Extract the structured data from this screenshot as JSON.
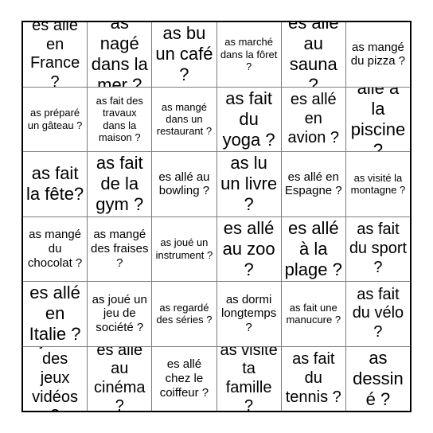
{
  "card": {
    "type": "bingo-card",
    "columns": 6,
    "rows": 6,
    "grid": [
      [
        {
          "text": "es allé en France ?",
          "size": "fs-lg"
        },
        {
          "text": "as nagé dans la mer ?",
          "size": "fs-xl"
        },
        {
          "text": "as bu un café ?",
          "size": "fs-xl"
        },
        {
          "text": "as marché dans la fôret ?",
          "size": "fs-xs"
        },
        {
          "text": "es allé au sauna ?",
          "size": "fs-xl"
        },
        {
          "text": "as mangé du pizza ?",
          "size": "fs-sm"
        }
      ],
      [
        {
          "text": "as préparé un gâteau ?",
          "size": "fs-xs"
        },
        {
          "text": "as fait des travaux dans la maison ?",
          "size": "fs-xs"
        },
        {
          "text": "as mangé dans un restaurant ?",
          "size": "fs-xs"
        },
        {
          "text": "as fait du yoga ?",
          "size": "fs-xl"
        },
        {
          "text": "es allé en avion ?",
          "size": "fs-lg"
        },
        {
          "text": "allé à la piscine ?",
          "size": "fs-xl"
        }
      ],
      [
        {
          "text": "as fait la fête?",
          "size": "fs-xl"
        },
        {
          "text": "as fait de la gym ?",
          "size": "fs-xl"
        },
        {
          "text": "es allé au bowling ?",
          "size": "fs-sm"
        },
        {
          "text": "as lu un livre ?",
          "size": "fs-xl"
        },
        {
          "text": "es allé en Espagne ?",
          "size": "fs-sm"
        },
        {
          "text": "as visité la montagne ?",
          "size": "fs-xs"
        }
      ],
      [
        {
          "text": "as mangé du chocolat ?",
          "size": "fs-sm"
        },
        {
          "text": "as mangé des fraises ?",
          "size": "fs-sm"
        },
        {
          "text": "as joué un instrument ?",
          "size": "fs-xs"
        },
        {
          "text": "es allé au zoo ?",
          "size": "fs-xl"
        },
        {
          "text": "es allé à la plage ?",
          "size": "fs-xl"
        },
        {
          "text": "as fait du sport ?",
          "size": "fs-lg"
        }
      ],
      [
        {
          "text": "es allé en Italie ?",
          "size": "fs-xl"
        },
        {
          "text": "as joué un jeu de société ?",
          "size": "fs-sm"
        },
        {
          "text": "as regardé des séries ?",
          "size": "fs-xs"
        },
        {
          "text": "as dormi longtemps ?",
          "size": "fs-sm"
        },
        {
          "text": "as fait une manucure ?",
          "size": "fs-xs"
        },
        {
          "text": "as fait du vélo ?",
          "size": "fs-lg"
        }
      ],
      [
        {
          "text": "joué des jeux vidéos ?",
          "size": "fs-lg"
        },
        {
          "text": "es allé au cinéma ?",
          "size": "fs-lg"
        },
        {
          "text": "es allé chez le coiffeur ?",
          "size": "fs-sm"
        },
        {
          "text": "as visité ta famille ?",
          "size": "fs-lg"
        },
        {
          "text": "as fait du tennis ?",
          "size": "fs-lg"
        },
        {
          "text": "as dessiné ?",
          "size": "fs-xl"
        }
      ]
    ]
  },
  "colors": {
    "outer_border": "#000000",
    "inner_grid_line": "#7d7d7d",
    "background": "#ffffff",
    "text": "#000000"
  }
}
